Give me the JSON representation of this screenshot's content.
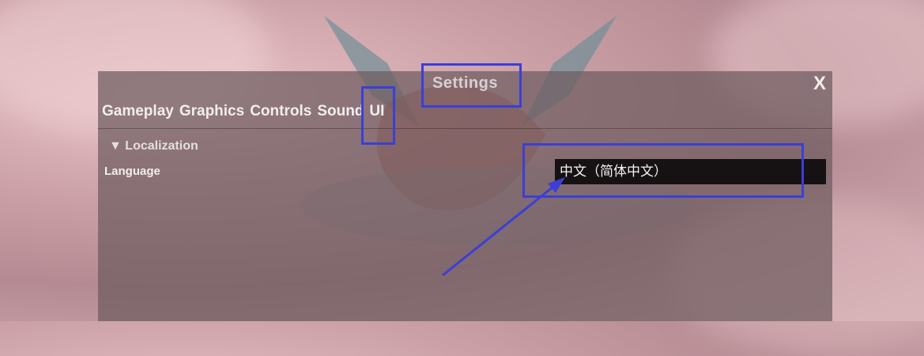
{
  "window": {
    "title": "Settings",
    "close_label": "X"
  },
  "tabs": [
    {
      "label": "Gameplay"
    },
    {
      "label": "Graphics"
    },
    {
      "label": "Controls"
    },
    {
      "label": "Sound"
    },
    {
      "label": "UI"
    }
  ],
  "localization": {
    "section_label": "Localization",
    "language_label": "Language",
    "language_value": "中文（简体中文）"
  },
  "colors": {
    "annotation": "#3b3fd6",
    "select_bg": "#161213"
  },
  "icons": {
    "section_toggle": "triangle-down-icon",
    "close": "close-icon"
  }
}
